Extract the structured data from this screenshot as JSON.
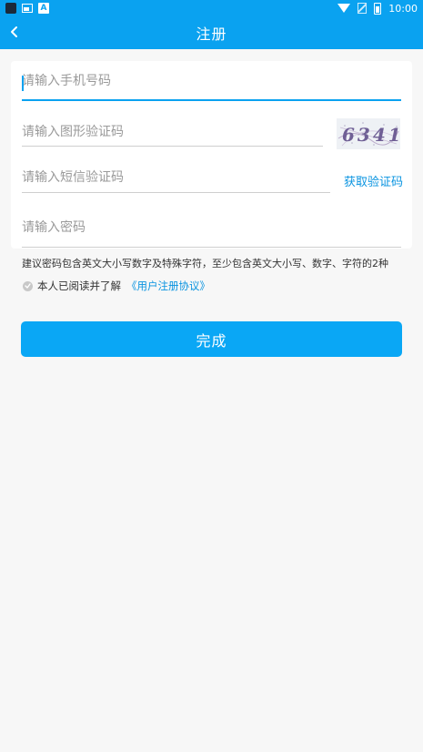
{
  "status_bar": {
    "time": "10:00"
  },
  "nav": {
    "title": "注册"
  },
  "form": {
    "phone_placeholder": "请输入手机号码",
    "captcha_placeholder": "请输入图形验证码",
    "captcha_text": "6341",
    "sms_placeholder": "请输入短信验证码",
    "sms_button": "获取验证码",
    "password_placeholder": "请输入密码"
  },
  "hint": "建议密码包含英文大小写数字及特殊字符，至少包含英文大小写、数字、字符的2种",
  "agreement": {
    "prefix": "本人已阅读并了解",
    "link": "《用户注册协议》"
  },
  "submit_label": "完成",
  "colors": {
    "primary": "#0aa2f0",
    "link": "#0a94e0"
  }
}
